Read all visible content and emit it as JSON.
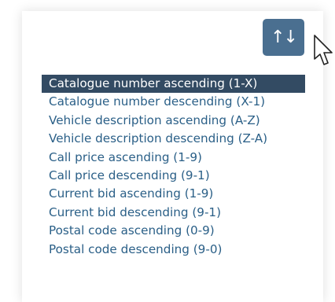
{
  "sort_button": {
    "icon": "sort-arrows-icon",
    "glyph": "↑↓"
  },
  "menu": {
    "selected_index": 0,
    "items": [
      "Catalogue number ascending (1-X)",
      "Catalogue number descending (X-1)",
      "Vehicle description ascending (A-Z)",
      "Vehicle description descending (Z-A)",
      "Call price ascending (1-9)",
      "Call price descending (9-1)",
      "Current bid ascending (1-9)",
      "Current bid descending (9-1)",
      "Postal code ascending (0-9)",
      "Postal code descending (9-0)"
    ]
  },
  "colors": {
    "button_bg": "#4a6f90",
    "selected_bg": "#334b63",
    "item_text": "#2a5f87"
  }
}
